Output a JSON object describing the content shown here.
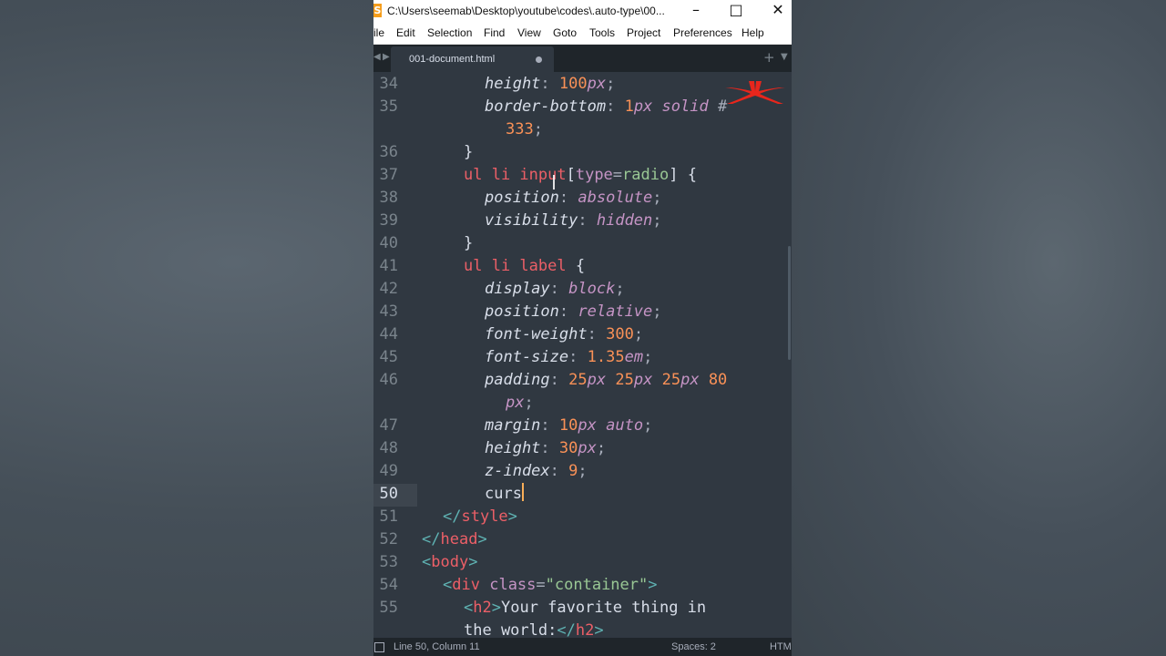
{
  "window": {
    "title": "C:\\Users\\seemab\\Desktop\\youtube\\codes\\.auto-type\\00...",
    "app_icon_glyph": "S",
    "minimize_glyph": "–",
    "maximize_glyph": "□",
    "close_glyph": "✕"
  },
  "menu": [
    "ile",
    "Edit",
    "Selection",
    "Find",
    "View",
    "Goto",
    "Tools",
    "Project",
    "Preferences",
    "Help"
  ],
  "tabs": {
    "active_label": "001-document.html",
    "nav_left": "◀",
    "nav_right": "▶",
    "new_tab": "+",
    "more": "▼"
  },
  "editor": {
    "line_numbers": [
      "34",
      "35",
      "",
      "36",
      "37",
      "38",
      "39",
      "40",
      "41",
      "42",
      "43",
      "44",
      "45",
      "46",
      "",
      "47",
      "48",
      "49",
      "50",
      "51",
      "52",
      "53",
      "54",
      "55",
      ""
    ],
    "active_line": "50",
    "code": {
      "l34": {
        "p": "height",
        "c": ":",
        "n": "100",
        "u": "px",
        "s": ";"
      },
      "l35": {
        "p": "border-bottom",
        "c": ":",
        "n": "1",
        "u": "px",
        "k": "solid",
        "h": "#"
      },
      "l35b": {
        "n": "333",
        "s": ";"
      },
      "l36": {
        "b": "}"
      },
      "l37": {
        "sel": "ul li input",
        "ob": "[",
        "attr": "type",
        "eq": "=",
        "val": "radio",
        "cb": "]",
        "brace": "{"
      },
      "l38": {
        "p": "position",
        "c": ":",
        "k": "absolute",
        "s": ";"
      },
      "l39": {
        "p": "visibility",
        "c": ":",
        "k": "hidden",
        "s": ";"
      },
      "l40": {
        "b": "}"
      },
      "l41": {
        "sel": "ul li label",
        "brace": "{"
      },
      "l42": {
        "p": "display",
        "c": ":",
        "k": "block",
        "s": ";"
      },
      "l43": {
        "p": "position",
        "c": ":",
        "k": "relative",
        "s": ";"
      },
      "l44": {
        "p": "font-weight",
        "c": ":",
        "n": "300",
        "s": ";"
      },
      "l45": {
        "p": "font-size",
        "c": ":",
        "n": "1.35",
        "u": "em",
        "s": ";"
      },
      "l46": {
        "p": "padding",
        "c": ":",
        "n1": "25",
        "u1": "px",
        "n2": "25",
        "u2": "px",
        "n3": "25",
        "u3": "px",
        "n4": "80"
      },
      "l46b": {
        "u": "px",
        "s": ";"
      },
      "l47": {
        "p": "margin",
        "c": ":",
        "n": "10",
        "u": "px",
        "k": "auto",
        "s": ";"
      },
      "l48": {
        "p": "height",
        "c": ":",
        "n": "30",
        "u": "px",
        "s": ";"
      },
      "l49": {
        "p": "z-index",
        "c": ":",
        "n": "9",
        "s": ";"
      },
      "l50": {
        "t": "curs"
      },
      "l51": {
        "o": "</",
        "tag": "style",
        "c": ">"
      },
      "l52": {
        "o": "</",
        "tag": "head",
        "c": ">"
      },
      "l53": {
        "o": "<",
        "tag": "body",
        "c": ">"
      },
      "l54": {
        "o": "<",
        "tag": "div",
        "attr": "class",
        "eq": "=",
        "str": "\"container\"",
        "c": ">"
      },
      "l55": {
        "o": "<",
        "tag": "h2",
        "c": ">",
        "text": "Your favorite thing in"
      },
      "l55b": {
        "text": "the world:",
        "o": "</",
        "tag": "h2",
        "c": ">"
      }
    }
  },
  "status": {
    "position": "Line 50, Column 11",
    "indent": "Spaces: 2",
    "syntax": "HTML"
  },
  "colors": {
    "editor_bg": "#303841",
    "selector": "#ec5f67",
    "keyword": "#c594c5",
    "number": "#f99157",
    "tag": "#5fb3b3",
    "string": "#99c794",
    "caret": "#f9ae58",
    "logo": "#e8261c"
  }
}
